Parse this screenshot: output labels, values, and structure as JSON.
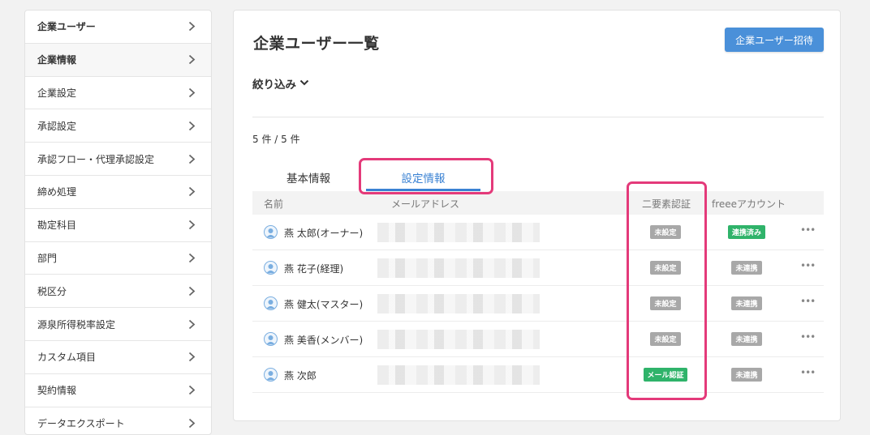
{
  "sidebar": {
    "items": [
      {
        "label": "企業ユーザー"
      },
      {
        "label": "企業情報"
      },
      {
        "label": "企業設定"
      },
      {
        "label": "承認設定"
      },
      {
        "label": "承認フロー・代理承認設定"
      },
      {
        "label": "締め処理"
      },
      {
        "label": "勘定科目"
      },
      {
        "label": "部門"
      },
      {
        "label": "税区分"
      },
      {
        "label": "源泉所得税率設定"
      },
      {
        "label": "カスタム項目"
      },
      {
        "label": "契約情報"
      },
      {
        "label": "データエクスポート"
      }
    ]
  },
  "main": {
    "title": "企業ユーザー一覧",
    "invite_label": "企業ユーザー招待",
    "filter_label": "絞り込み",
    "count": "5 件 / 5 件",
    "tabs": [
      {
        "label": "基本情報"
      },
      {
        "label": "設定情報"
      }
    ],
    "columns": {
      "name": "名前",
      "email": "メールアドレス",
      "two_factor": "二要素認証",
      "freee_account": "freeeアカウント"
    },
    "rows": [
      {
        "name": "燕 太郎(オーナー)",
        "two_factor": "未設定",
        "freee": "連携済み"
      },
      {
        "name": "燕 花子(経理)",
        "two_factor": "未設定",
        "freee": "未連携"
      },
      {
        "name": "燕 健太(マスター)",
        "two_factor": "未設定",
        "freee": "未連携"
      },
      {
        "name": "燕 美香(メンバー)",
        "two_factor": "未設定",
        "freee": "未連携"
      },
      {
        "name": "燕 次郎",
        "two_factor": "メール認証",
        "freee": "未連携"
      }
    ],
    "more_label": "•••"
  },
  "colors": {
    "accent": "#4a90d9",
    "tab_active": "#3a82d3",
    "badge_green": "#2fb36a",
    "badge_gray": "#a8a8a8",
    "highlight": "#e43a7a"
  }
}
